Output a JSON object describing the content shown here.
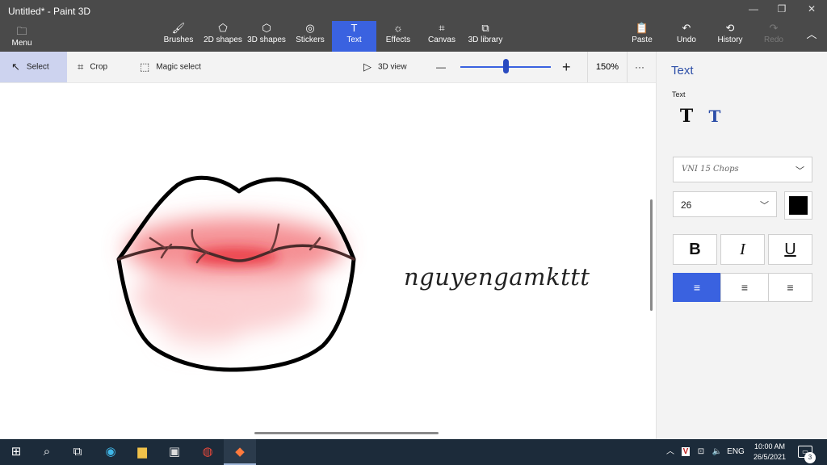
{
  "window": {
    "title": "Untitled* - Paint 3D",
    "controls": [
      "—",
      "❐",
      "✕"
    ]
  },
  "ribbon": {
    "menu": {
      "label": "Menu",
      "icon": "folder-icon"
    },
    "tabs": [
      {
        "label": "Brushes",
        "icon": "brush-icon",
        "active": false
      },
      {
        "label": "2D shapes",
        "icon": "2d-shapes-icon",
        "active": false
      },
      {
        "label": "3D shapes",
        "icon": "cube-icon",
        "active": false
      },
      {
        "label": "Stickers",
        "icon": "sticker-icon",
        "active": false
      },
      {
        "label": "Text",
        "icon": "text-icon",
        "active": true
      },
      {
        "label": "Effects",
        "icon": "sun-icon",
        "active": false
      },
      {
        "label": "Canvas",
        "icon": "canvas-icon",
        "active": false
      },
      {
        "label": "3D library",
        "icon": "3d-library-icon",
        "active": false
      }
    ],
    "right": [
      {
        "label": "Paste",
        "icon": "clipboard-icon",
        "disabled": false
      },
      {
        "label": "Undo",
        "icon": "undo-icon",
        "disabled": false
      },
      {
        "label": "History",
        "icon": "history-icon",
        "disabled": false
      },
      {
        "label": "Redo",
        "icon": "redo-icon",
        "disabled": true
      }
    ]
  },
  "toolbar": {
    "select": "Select",
    "crop": "Crop",
    "magic_select": "Magic select",
    "view_3d": "3D view",
    "zoom_minus": "—",
    "zoom_plus": "+",
    "zoom": "150%",
    "more": "···",
    "zoom_level_fraction": 0.5
  },
  "canvas": {
    "text": "nguyengamkttt",
    "lip_color": "#ec3b41"
  },
  "panel": {
    "title": "Text",
    "section": "Text",
    "font": "VNI 15 Chops",
    "size": "26",
    "color": "#000000",
    "bold": "B",
    "italic": "I",
    "underline": "U",
    "alignments": [
      "left",
      "center",
      "right"
    ],
    "active_alignment": "left"
  },
  "taskbar": {
    "lang": "ENG",
    "time": "10:00 AM",
    "date": "26/5/2021",
    "notifications": "3"
  }
}
